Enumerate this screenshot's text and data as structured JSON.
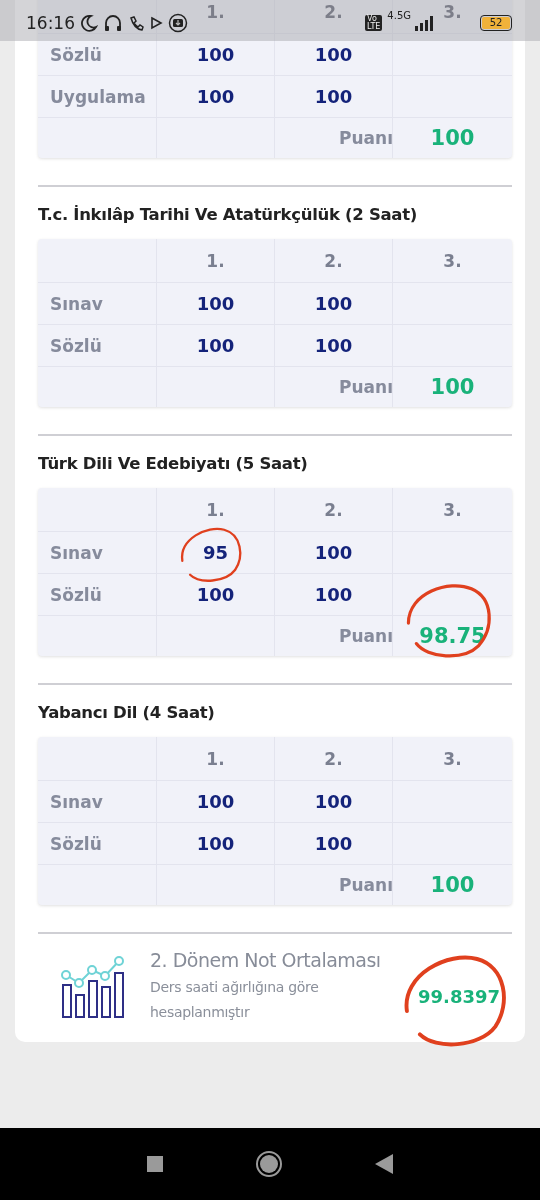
{
  "status_bar": {
    "time": "16:16",
    "volte": [
      "Vo",
      "LTE"
    ],
    "network": "4.5G",
    "battery": "52"
  },
  "courses": [
    {
      "columns": [
        "1.",
        "2.",
        "3."
      ],
      "rows": [
        {
          "label": "Sözlü",
          "values": [
            {
              "text": "100",
              "circled": false
            },
            {
              "text": "100",
              "circled": false
            }
          ]
        },
        {
          "label": "Uygulama",
          "values": [
            {
              "text": "100",
              "circled": false
            },
            {
              "text": "100",
              "circled": false
            }
          ]
        }
      ],
      "score_label": "Puanı",
      "score": {
        "text": "100",
        "circled": false
      }
    },
    {
      "title": "T.c. İnkılâp Tarihi Ve Atatürkçülük (2 Saat)",
      "columns": [
        "1.",
        "2.",
        "3."
      ],
      "rows": [
        {
          "label": "Sınav",
          "values": [
            {
              "text": "100",
              "circled": false
            },
            {
              "text": "100",
              "circled": false
            }
          ]
        },
        {
          "label": "Sözlü",
          "values": [
            {
              "text": "100",
              "circled": false
            },
            {
              "text": "100",
              "circled": false
            }
          ]
        }
      ],
      "score_label": "Puanı",
      "score": {
        "text": "100",
        "circled": false
      }
    },
    {
      "title": "Türk Dili Ve Edebiyatı (5 Saat)",
      "columns": [
        "1.",
        "2.",
        "3."
      ],
      "rows": [
        {
          "label": "Sınav",
          "values": [
            {
              "text": "95",
              "circled": true
            },
            {
              "text": "100",
              "circled": false
            }
          ]
        },
        {
          "label": "Sözlü",
          "values": [
            {
              "text": "100",
              "circled": false
            },
            {
              "text": "100",
              "circled": false
            }
          ]
        }
      ],
      "score_label": "Puanı",
      "score": {
        "text": "98.75",
        "circled": true
      }
    },
    {
      "title": "Yabancı Dil (4 Saat)",
      "columns": [
        "1.",
        "2.",
        "3."
      ],
      "rows": [
        {
          "label": "Sınav",
          "values": [
            {
              "text": "100",
              "circled": false
            },
            {
              "text": "100",
              "circled": false
            }
          ]
        },
        {
          "label": "Sözlü",
          "values": [
            {
              "text": "100",
              "circled": false
            },
            {
              "text": "100",
              "circled": false
            }
          ]
        }
      ],
      "score_label": "Puanı",
      "score": {
        "text": "100",
        "circled": false
      }
    }
  ],
  "summary": {
    "title": "2. Dönem Not Ortalaması",
    "subtitle": "Ders saati ağırlığına göre hesaplanmıştır",
    "value": {
      "text": "99.8397",
      "circled": true
    }
  }
}
